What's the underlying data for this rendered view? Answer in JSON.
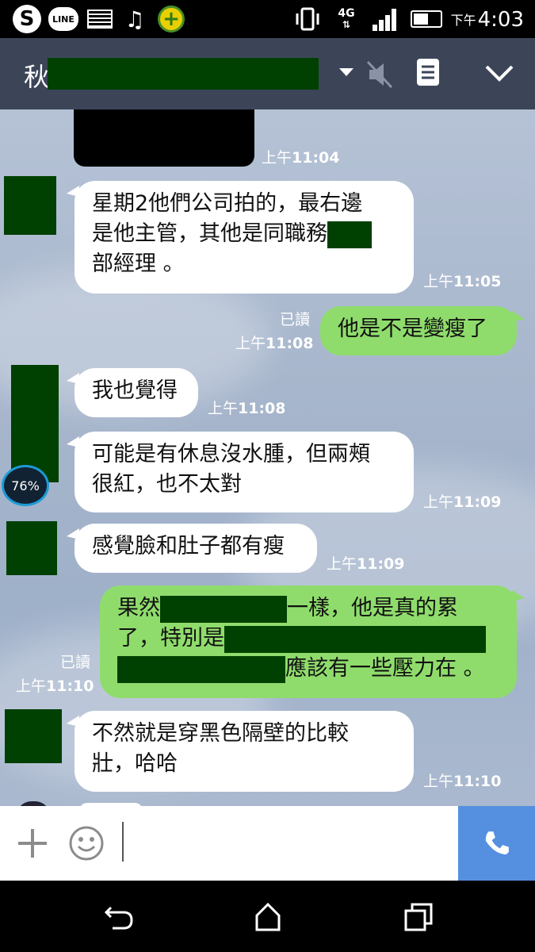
{
  "status_bar": {
    "icons": [
      "skype-icon",
      "line-icon",
      "image-icon",
      "music-icon",
      "plus-app-icon",
      "vibrate-icon",
      "network-icon",
      "signal-icon",
      "battery-icon"
    ],
    "skype_glyph": "S",
    "line_label": "LINE",
    "network": "4G",
    "ampm": "下午",
    "clock": "4:03"
  },
  "header": {
    "title_char": "秋"
  },
  "messages": {
    "m1": {
      "time_pre": "上午",
      "time": "11:04"
    },
    "m2": {
      "lines": [
        "星期2他們公司拍的，最右邊",
        "是他主管，其他是同職務",
        "部經理 。"
      ],
      "time_pre": "上午",
      "time": "11:05"
    },
    "m3": {
      "text": "他是不是變瘦了",
      "read": "已讀",
      "time_pre": "上午",
      "time": "11:08"
    },
    "m4": {
      "text": "我也覺得",
      "time_pre": "上午",
      "time": "11:08"
    },
    "m5": {
      "lines": [
        "可能是有休息沒水腫，但兩頰",
        "很紅，也不太對"
      ],
      "time_pre": "上午",
      "time": "11:09"
    },
    "m6": {
      "text": "感覺臉和肚子都有瘦",
      "time_pre": "上午",
      "time": "11:09"
    },
    "m7": {
      "line1_a": "果然",
      "line1_b": "一樣，他是真的累",
      "line2_a": "了，特別是",
      "line3_b": "應該有一些壓力在 。",
      "read": "已讀",
      "time_pre": "上午",
      "time": "11:10"
    },
    "m8": {
      "lines": [
        "不然就是穿黑色隔壁的比較",
        "壯，哈哈"
      ],
      "time_pre": "上午",
      "time": "11:10"
    }
  },
  "avatar_badge": "76%",
  "input": {
    "placeholder": ""
  },
  "colors": {
    "header": "#3c4558",
    "outgoing_bubble": "#8fdc6c",
    "incoming_bubble": "#ffffff",
    "call_button": "#5590e0",
    "redaction": "#004000"
  }
}
